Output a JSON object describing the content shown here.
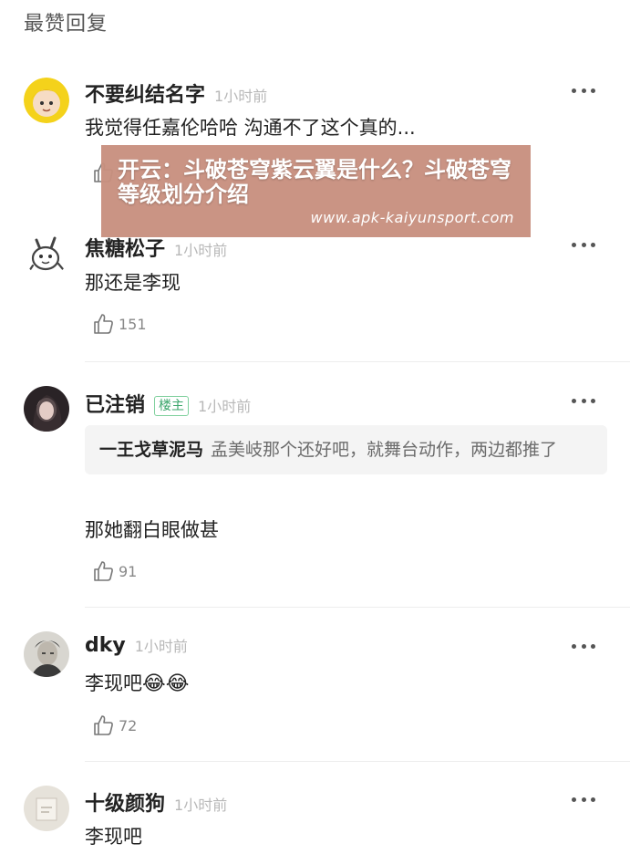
{
  "section_title": "最赞回复",
  "comments": [
    {
      "username": "不要纠结名字",
      "time": "1小时前",
      "text": "我觉得任嘉伦哈哈  沟通不了这个真的...",
      "avatar_icon": "avatar-yellow-hood-icon"
    },
    {
      "username": "焦糖松子",
      "time": "1小时前",
      "text": "那还是李现",
      "likes": "151",
      "avatar_icon": "avatar-cartoon-bunny-icon"
    },
    {
      "username": "已注销",
      "badge": "楼主",
      "time": "1小时前",
      "quote_user": "一王戈草泥马",
      "quote_text": "孟美岐那个还好吧，就舞台动作，两边都推了",
      "text": "那她翻白眼做甚",
      "likes": "91",
      "avatar_icon": "avatar-dark-portrait-icon"
    },
    {
      "username": "dky",
      "time": "1小时前",
      "text": "李现吧",
      "emoji": "😂😂",
      "likes": "72",
      "avatar_icon": "avatar-sketch-portrait-icon"
    },
    {
      "username": "十级颜狗",
      "time": "1小时前",
      "text": "李现吧",
      "avatar_icon": "avatar-paper-icon"
    }
  ],
  "overlay": {
    "headline": "开云：斗破苍穹紫云翼是什么？斗破苍穹等级划分介绍",
    "url": "www.apk-kaiyunsport.com"
  },
  "colors": {
    "overlay_bg": "#c8907f",
    "badge_green": "#3aa56a",
    "muted_text": "#b8b8b8"
  }
}
